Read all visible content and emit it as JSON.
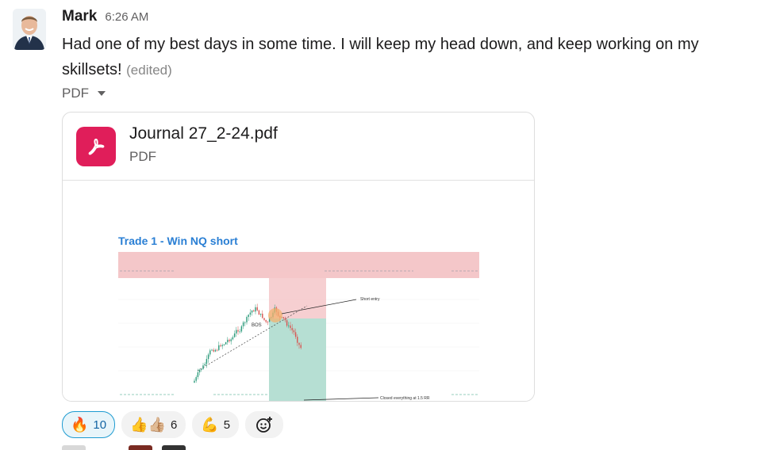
{
  "message": {
    "author": "Mark",
    "time": "6:26 AM",
    "text": "Had one of my best days in some time. I will keep my head down, and keep working on my skillsets!",
    "edited": "(edited)"
  },
  "attachment": {
    "toggle_label": "PDF",
    "file_name": "Journal 27_2-24.pdf",
    "file_type": "PDF",
    "preview": {
      "title": "Trade 1 - Win NQ short",
      "labels": {
        "short_entry": "Short entry",
        "bos": "BOS",
        "closed": "Closed everything at 1.5 RR"
      }
    }
  },
  "reactions": [
    {
      "emoji": "🔥",
      "count": "10",
      "active": true
    },
    {
      "emoji": "👍👍🏼",
      "count": "6",
      "active": false
    },
    {
      "emoji": "💪",
      "count": "5",
      "active": false
    }
  ],
  "colors": {
    "pdf_icon": "#e01e5a",
    "link_blue": "#1264a3",
    "chart_title": "#2a7fd4",
    "zone_red": "#f4c7c9",
    "zone_green": "#b6dfd3"
  }
}
